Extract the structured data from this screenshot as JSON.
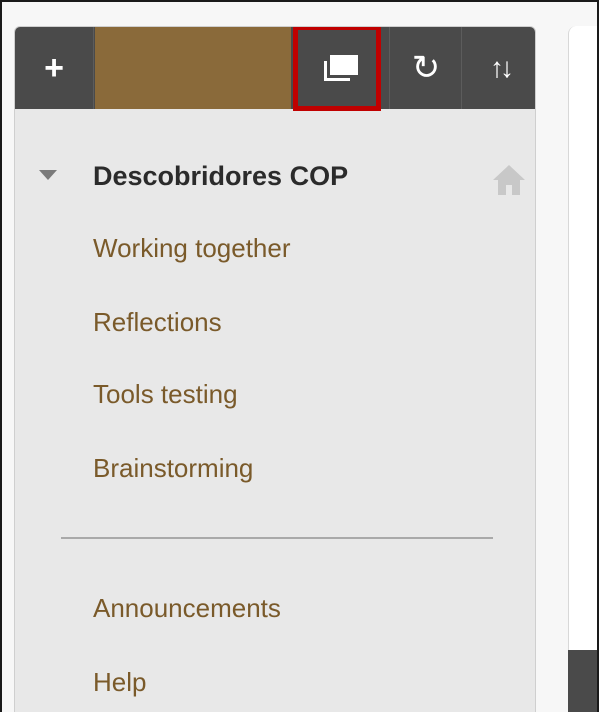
{
  "toolbar": {
    "add_icon": "plus-icon",
    "add_glyph": "+",
    "display_icon": "display-mode-icon",
    "refresh_icon": "refresh-icon",
    "refresh_glyph": "↻",
    "reorder_icon": "reorder-icon",
    "reorder_glyph": "↑↓",
    "brand_color": "#8a6a3a",
    "highlight_color": "#c00000"
  },
  "course": {
    "title": "Descobridores COP",
    "expand_icon": "collapse-triangle-icon",
    "home_icon": "home-icon"
  },
  "menu": {
    "items": [
      {
        "label": "Working together"
      },
      {
        "label": "Reflections"
      },
      {
        "label": "Tools testing"
      },
      {
        "label": "Brainstorming"
      }
    ],
    "secondary_items": [
      {
        "label": "Announcements"
      },
      {
        "label": "Help"
      }
    ],
    "link_color": "#7a5a2a"
  }
}
